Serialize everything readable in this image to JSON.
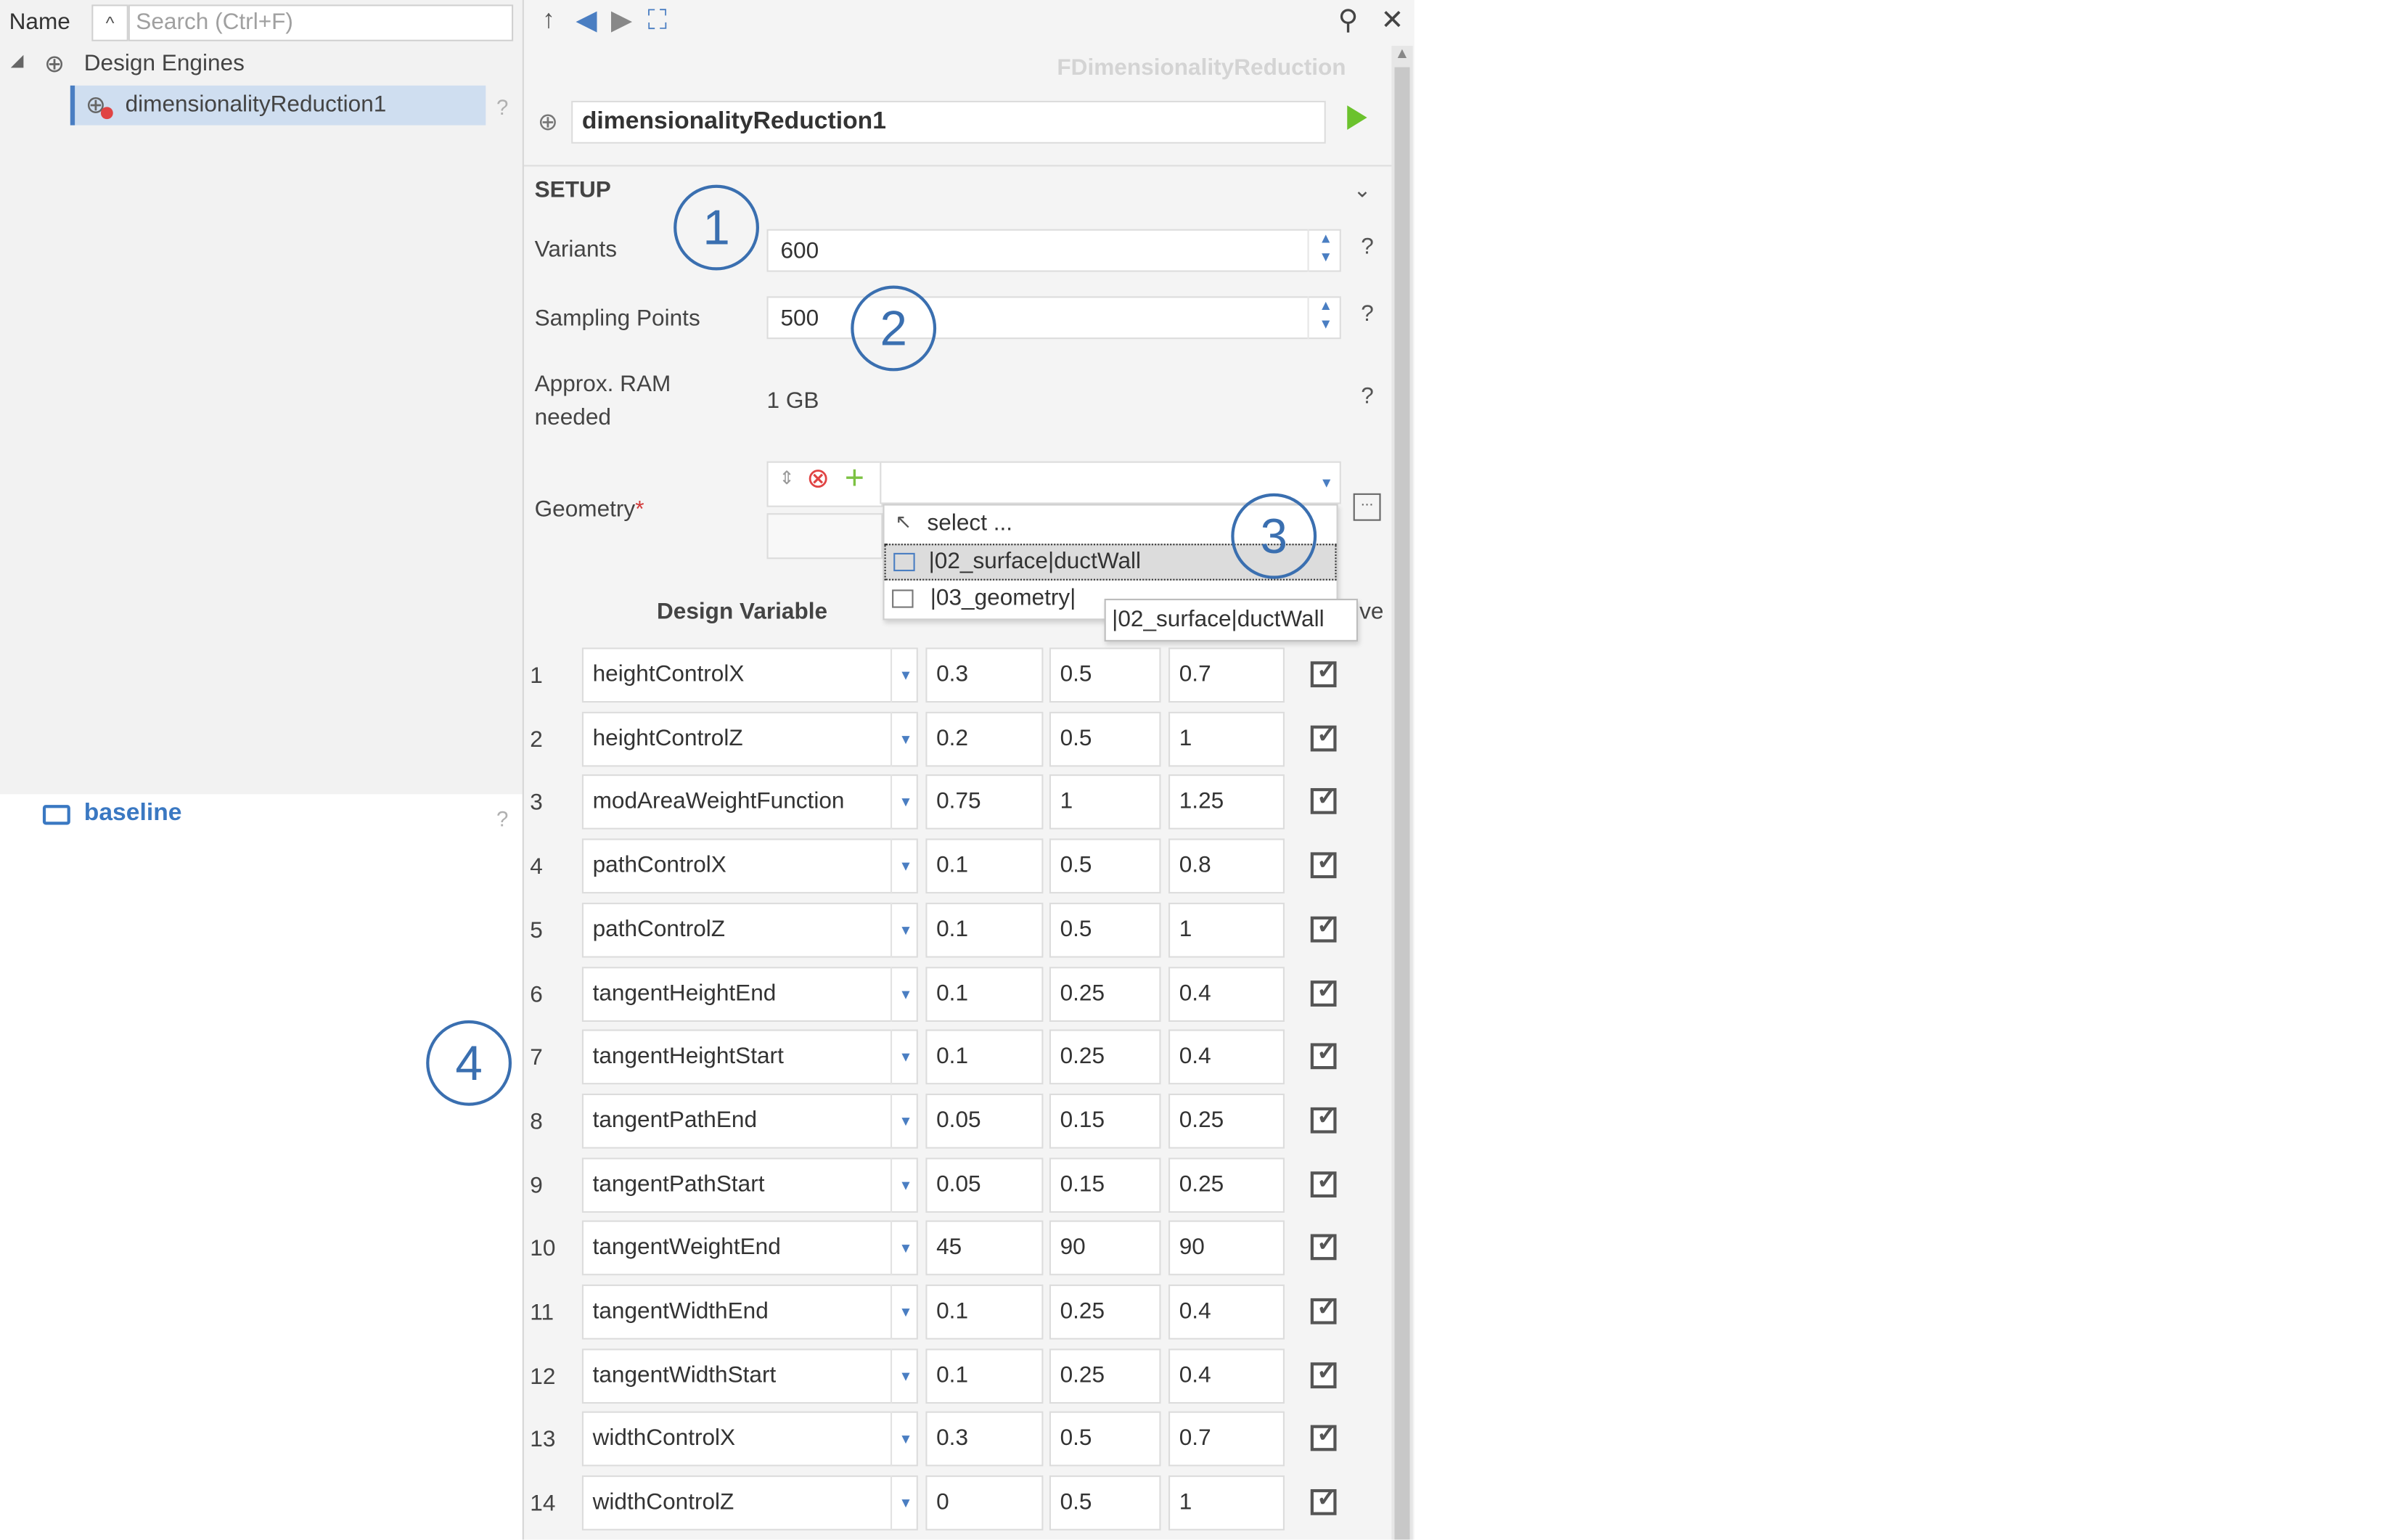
{
  "tree": {
    "name_header": "Name",
    "search_placeholder": "Search (Ctrl+F)",
    "items": [
      {
        "label": "Design Engines"
      },
      {
        "label": "dimensionalityReduction1"
      }
    ],
    "help_mark": "?",
    "baseline_label": "baseline"
  },
  "panel": {
    "class_title": "FDimensionalityReduction",
    "instance_name": "dimensionalityReduction1",
    "section_title": "SETUP",
    "fields": {
      "variants": {
        "label": "Variants",
        "value": "600"
      },
      "sampling": {
        "label": "Sampling Points",
        "value": "500"
      },
      "ram": {
        "label_line1": "Approx. RAM",
        "label_line2": "needed",
        "value": "1 GB"
      },
      "geometry": {
        "label": "Geometry",
        "required_mark": "*"
      }
    },
    "help_mark": "?",
    "dropdown": {
      "items": [
        {
          "label": "select ..."
        },
        {
          "label": "|02_surface|ductWall"
        },
        {
          "label": "|03_geometry|"
        }
      ],
      "tooltip": "|02_surface|ductWall"
    },
    "table": {
      "header_design_variable": "Design Variable",
      "header_active_partial": "ve",
      "rows": [
        {
          "n": "1",
          "name": "heightControlX",
          "lower": "0.3",
          "mid": "0.5",
          "upper": "0.7"
        },
        {
          "n": "2",
          "name": "heightControlZ",
          "lower": "0.2",
          "mid": "0.5",
          "upper": "1"
        },
        {
          "n": "3",
          "name": "modAreaWeightFunction",
          "lower": "0.75",
          "mid": "1",
          "upper": "1.25"
        },
        {
          "n": "4",
          "name": "pathControlX",
          "lower": "0.1",
          "mid": "0.5",
          "upper": "0.8"
        },
        {
          "n": "5",
          "name": "pathControlZ",
          "lower": "0.1",
          "mid": "0.5",
          "upper": "1"
        },
        {
          "n": "6",
          "name": "tangentHeightEnd",
          "lower": "0.1",
          "mid": "0.25",
          "upper": "0.4"
        },
        {
          "n": "7",
          "name": "tangentHeightStart",
          "lower": "0.1",
          "mid": "0.25",
          "upper": "0.4"
        },
        {
          "n": "8",
          "name": "tangentPathEnd",
          "lower": "0.05",
          "mid": "0.15",
          "upper": "0.25"
        },
        {
          "n": "9",
          "name": "tangentPathStart",
          "lower": "0.05",
          "mid": "0.15",
          "upper": "0.25"
        },
        {
          "n": "10",
          "name": "tangentWeightEnd",
          "lower": "45",
          "mid": "90",
          "upper": "90"
        },
        {
          "n": "11",
          "name": "tangentWidthEnd",
          "lower": "0.1",
          "mid": "0.25",
          "upper": "0.4"
        },
        {
          "n": "12",
          "name": "tangentWidthStart",
          "lower": "0.1",
          "mid": "0.25",
          "upper": "0.4"
        },
        {
          "n": "13",
          "name": "widthControlX",
          "lower": "0.3",
          "mid": "0.5",
          "upper": "0.7"
        },
        {
          "n": "14",
          "name": "widthControlZ",
          "lower": "0",
          "mid": "0.5",
          "upper": "1"
        }
      ]
    }
  },
  "callouts": [
    "1",
    "2",
    "3",
    "4"
  ],
  "colors": {
    "accent": "#4a7ec2",
    "run": "#6bc22c",
    "callout": "#3a6fb0",
    "selected": "#cfdef0"
  }
}
